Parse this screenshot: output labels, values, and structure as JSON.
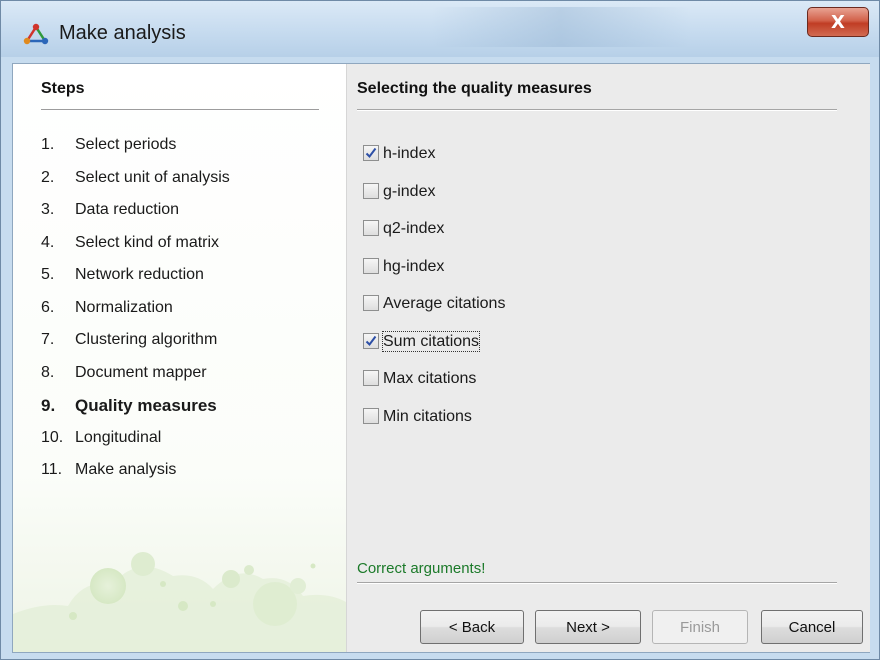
{
  "window": {
    "title": "Make analysis",
    "close_label": "X"
  },
  "steps": {
    "title": "Steps",
    "items": [
      {
        "num": "1.",
        "label": "Select periods"
      },
      {
        "num": "2.",
        "label": "Select unit of analysis"
      },
      {
        "num": "3.",
        "label": "Data reduction"
      },
      {
        "num": "4.",
        "label": "Select kind of matrix"
      },
      {
        "num": "5.",
        "label": "Network reduction"
      },
      {
        "num": "6.",
        "label": "Normalization"
      },
      {
        "num": "7.",
        "label": "Clustering algorithm"
      },
      {
        "num": "8.",
        "label": "Document mapper"
      },
      {
        "num": "9.",
        "label": "Quality measures"
      },
      {
        "num": "10.",
        "label": "Longitudinal"
      },
      {
        "num": "11.",
        "label": "Make analysis"
      }
    ],
    "current_index": 8
  },
  "content": {
    "title": "Selecting the quality measures",
    "options": [
      {
        "label": "h-index",
        "checked": true
      },
      {
        "label": "g-index",
        "checked": false
      },
      {
        "label": "q2-index",
        "checked": false
      },
      {
        "label": "hg-index",
        "checked": false
      },
      {
        "label": "Average citations",
        "checked": false
      },
      {
        "label": "Sum citations",
        "checked": true
      },
      {
        "label": "Max citations",
        "checked": false
      },
      {
        "label": "Min citations",
        "checked": false
      }
    ],
    "status": "Correct arguments!"
  },
  "buttons": {
    "back": "< Back",
    "next": "Next >",
    "finish": "Finish",
    "cancel": "Cancel"
  },
  "colors": {
    "status_text": "#1c7a2a",
    "check_mark": "#2d4fa6",
    "close_button": "#c03d24"
  }
}
